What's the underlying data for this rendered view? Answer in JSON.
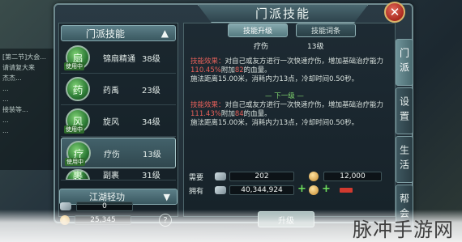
{
  "panel": {
    "title": "门派技能",
    "close_icon": "close-icon"
  },
  "left_strip": {
    "lines": [
      "[第二节]大会...",
      "请请复大来",
      "杰杰...",
      "...",
      "...",
      "接装等...",
      "...",
      "..."
    ]
  },
  "skill_list": {
    "header": "门派技能",
    "header_arrow": "▲",
    "skills": [
      {
        "name": "锦扇精通",
        "level": "38级",
        "glyph": "扇",
        "in_use": "使用中"
      },
      {
        "name": "药禹",
        "level": "23级",
        "glyph": "药",
        "in_use": ""
      },
      {
        "name": "旋风",
        "level": "34级",
        "glyph": "风",
        "in_use": "使用中"
      },
      {
        "name": "疗伤",
        "level": "13级",
        "glyph": "疗",
        "in_use": "使用中"
      },
      {
        "name": "副裹",
        "level": "31级",
        "glyph": "裹",
        "in_use": ""
      }
    ],
    "sub_header": "江湖轻功",
    "sub_arrow": "▼"
  },
  "detail": {
    "tabs": [
      "技能升级",
      "技能词条"
    ],
    "skill_name": "疗伤",
    "skill_level": "13级",
    "current_effect": {
      "key": "技能效果：",
      "text1": "对自己或友方进行一次快速疗伤，增加基础治疗能力",
      "pct": "110.45%",
      "text2": "附加",
      "add": "82",
      "text3": "的血量。",
      "text4": "施法距离15.00米，消耗内力13点，冷却时间0.50秒。"
    },
    "next_label": "下一级",
    "next_effect": {
      "key": "技能效果：",
      "text1": "对自己或友方进行一次快速疗伤，增加基础治疗能力",
      "pct": "111.43%",
      "text2": "附加",
      "add": "84",
      "text3": "的血量。",
      "text4": "施法距离15.00米，消耗内力13点，冷却时间0.50秒。"
    },
    "need_label": "需要",
    "own_label": "拥有",
    "need_stone": "202",
    "need_coin": "12,000",
    "own_stone": "40,344,924",
    "upgrade_button": "升级"
  },
  "side_tabs": [
    "门派",
    "设置",
    "生活",
    "帮会"
  ],
  "resources": {
    "top_value": "0",
    "bottom_value": "25,345",
    "help": "?"
  },
  "watermark": "脉冲手游网"
}
